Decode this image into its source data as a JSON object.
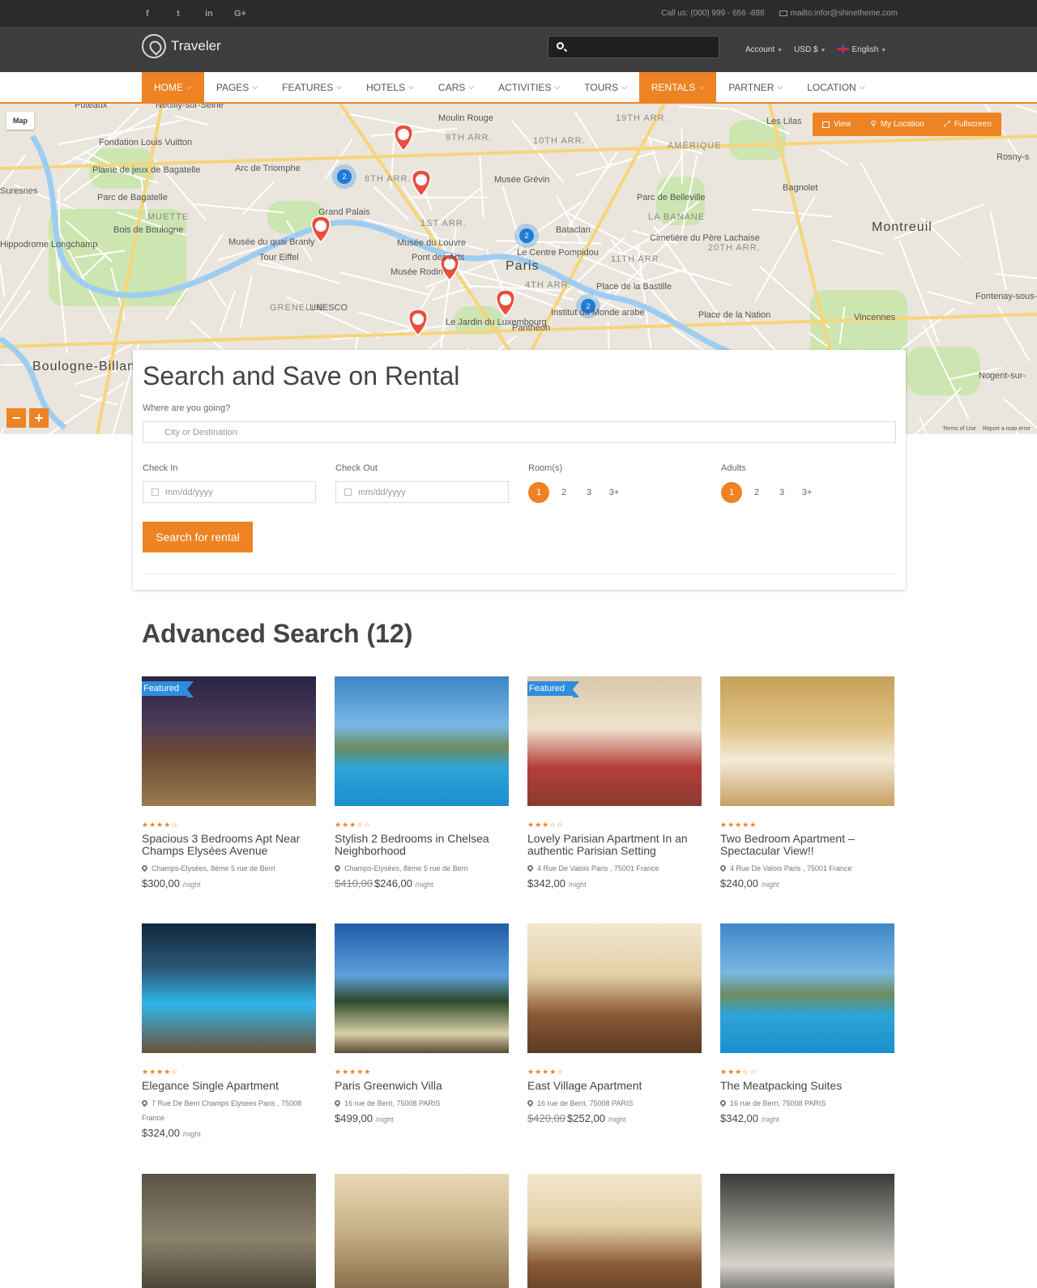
{
  "topbar": {
    "social": [
      "f",
      "t",
      "in",
      "G+"
    ],
    "phone": "Call us: (000) 999 - 656 -888",
    "email": "mailto:infor@shinetheme.com"
  },
  "header": {
    "logo": "Traveler",
    "search_placeholder": "",
    "account": "Account",
    "currency": "USD $",
    "language": "English"
  },
  "nav": [
    {
      "label": "HOME",
      "active": true
    },
    {
      "label": "PAGES",
      "active": false
    },
    {
      "label": "FEATURES",
      "active": false
    },
    {
      "label": "HOTELS",
      "active": false
    },
    {
      "label": "CARS",
      "active": false
    },
    {
      "label": "ACTIVITIES",
      "active": false
    },
    {
      "label": "TOURS",
      "active": false
    },
    {
      "label": "RENTALS",
      "active": true
    },
    {
      "label": "PARTNER",
      "active": false
    },
    {
      "label": "LOCATION",
      "active": false
    }
  ],
  "map": {
    "type_label": "Map",
    "ctrl_view": "View",
    "ctrl_location": "My Location",
    "ctrl_fullscreen": "Fullscreen",
    "zoom_out": "−",
    "zoom_in": "+",
    "terms": "Terms of Use",
    "report": "Report a map error",
    "labels": [
      "Neuilly-sur-Seine",
      "Puteaux",
      "Fondation Louis Vuitton",
      "Arc de Triomphe",
      "Moulin Rouge",
      "9TH ARR.",
      "10TH ARR.",
      "19TH ARR.",
      "Les Lilas",
      "AMÉRIQUE",
      "8TH ARR.",
      "Musée Grévin",
      "Bagnolet",
      "Plaine de jeux de Bagatelle",
      "Parc de Bagatelle",
      "MUETTE",
      "Bois de Boulogne",
      "Grand Palais",
      "1ST ARR.",
      "Parc de Belleville",
      "LA BANANE",
      "Montreuil",
      "Musée du quai Branly",
      "Musée du Louvre",
      "Bataclan",
      "Cimetière du Père Lachaise",
      "20TH ARR.",
      "Hippodrome Longchamp",
      "Tour Eiffel",
      "Musée Rodin",
      "Le Centre Pompidou",
      "Paris",
      "11TH ARR.",
      "4TH ARR.",
      "Place de la Bastille",
      "GRENELLE",
      "UNESCO",
      "Institut du Monde arabe",
      "Place de la Nation",
      "Fontenay-sous-Bois",
      "Le Jardin du Luxembourg",
      "Panthéon",
      "Vincennes",
      "Boulogne-Billancourt",
      "Nogent-sur-",
      "Rosny-s",
      "Suresnes",
      "Pont des Arts"
    ],
    "pins": 7,
    "clusters": [
      "2",
      "2",
      "2"
    ]
  },
  "search": {
    "title": "Search and Save on Rental",
    "where_label": "Where are you going?",
    "where_placeholder": "City or Destination",
    "checkin_label": "Check In",
    "checkout_label": "Check Out",
    "date_placeholder": "mm/dd/yyyy",
    "rooms_label": "Room(s)",
    "adults_label": "Adults",
    "counts": [
      "1",
      "2",
      "3",
      "3+"
    ],
    "rooms_selected": "1",
    "adults_selected": "1",
    "button": "Search for rental"
  },
  "results": {
    "title": "Advanced Search (12)",
    "per_night": "/night",
    "featured_label": "Featured",
    "items": [
      {
        "title": "Spacious 3 Bedrooms Apt Near Champs Elysées Avenue",
        "address": "Champs-Elysées, 8ème 5 rue de Berri",
        "old_price": "",
        "price": "$300,00",
        "stars": "★★★★☆",
        "featured": true,
        "img": "room-dark"
      },
      {
        "title": "Stylish 2 Bedrooms in Chelsea Neighborhood",
        "address": "Champs-Elysées, 8ème 5 rue de Berri",
        "old_price": "$410,00",
        "price": "$246,00",
        "stars": "★★★☆☆",
        "featured": false,
        "img": "pool"
      },
      {
        "title": "Lovely Parisian Apartment In an authentic Parisian Setting",
        "address": "4 Rue De Valois Paris , 75001 France",
        "old_price": "",
        "price": "$342,00",
        "stars": "★★★☆☆",
        "featured": true,
        "img": "bedroom-warm"
      },
      {
        "title": "Two Bedroom Apartment – Spectacular View!!",
        "address": "4 Rue De Valois Paris , 75001 France",
        "old_price": "",
        "price": "$240,00",
        "stars": "★★★★★",
        "featured": false,
        "img": "bedroom-twin"
      },
      {
        "title": "Elegance Single Apartment",
        "address": "7 Rue De Berri Champs Elysees Paris , 75008 France",
        "old_price": "",
        "price": "$324,00",
        "stars": "★★★★☆",
        "featured": false,
        "img": "pool-night"
      },
      {
        "title": "Paris Greenwich Villa",
        "address": "16 rue de Berri, 75008 PARIS",
        "old_price": "",
        "price": "$499,00",
        "stars": "★★★★★",
        "featured": false,
        "img": "beach"
      },
      {
        "title": "East Village Apartment",
        "address": "16 rue de Berri, 75008 PARIS",
        "old_price": "$420,00",
        "price": "$252,00",
        "stars": "★★★★☆",
        "featured": false,
        "img": "lounge"
      },
      {
        "title": "The Meatpacking Suites",
        "address": "16 rue de Berri, 75008 PARIS",
        "old_price": "",
        "price": "$342,00",
        "stars": "★★★☆☆",
        "featured": false,
        "img": "pool"
      },
      {
        "title": "",
        "address": "",
        "old_price": "",
        "price": "",
        "stars": "",
        "featured": false,
        "img": "room-grey"
      },
      {
        "title": "",
        "address": "",
        "old_price": "",
        "price": "",
        "stars": "",
        "featured": false,
        "img": "lounge-bright"
      },
      {
        "title": "",
        "address": "",
        "old_price": "",
        "price": "",
        "stars": "",
        "featured": false,
        "img": "lounge"
      },
      {
        "title": "",
        "address": "",
        "old_price": "",
        "price": "",
        "stars": "",
        "featured": false,
        "img": "hotel-room"
      }
    ]
  },
  "colors": {
    "accent": "#ed8323",
    "featured": "#2f8ddf",
    "topbar": "#2b2b2b",
    "header": "#3d3d3d"
  }
}
